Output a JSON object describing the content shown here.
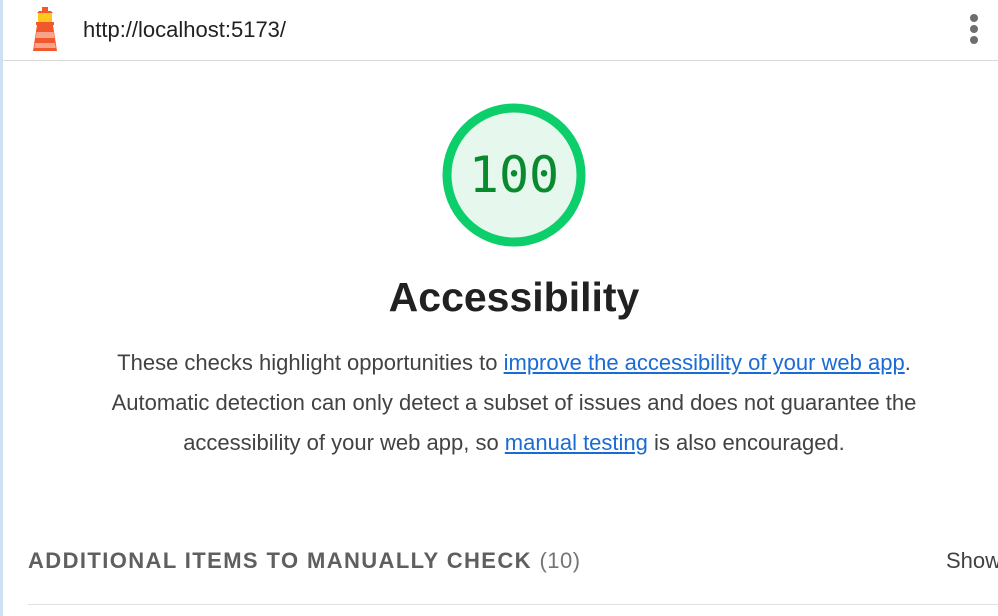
{
  "header": {
    "url": "http://localhost:5173/",
    "logo_icon": "lighthouse-icon",
    "menu_icon": "more-vert-icon"
  },
  "score": {
    "value": "100",
    "fraction": 1.0,
    "ring_color": "#0cce6b",
    "fill_color": "#e6f8ed",
    "text_color": "#0a8a2e"
  },
  "category": {
    "title": "Accessibility",
    "description": {
      "part1": "These checks highlight opportunities to ",
      "link1": "improve the accessibility of your web app",
      "part2": ". Automatic detection can only detect a subset of issues and does not guarantee the accessibility of your web app, so ",
      "link2": "manual testing",
      "part3": " is also encouraged."
    }
  },
  "manual_section": {
    "title": "Additional items to manually check",
    "count": "(10)",
    "toggle_label": "Show"
  },
  "colors": {
    "link": "#1a6bd6",
    "section_title": "#5f5f5f"
  }
}
